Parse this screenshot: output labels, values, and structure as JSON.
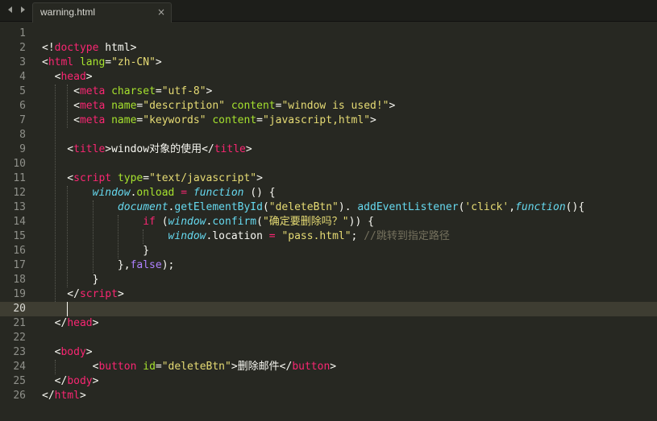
{
  "tab": {
    "title": "warning.html",
    "close_glyph": "×",
    "nav_back_icon": "triangle-left-icon",
    "nav_forward_icon": "triangle-right-icon"
  },
  "editor": {
    "current_line": 20,
    "theme": {
      "background": "#272822",
      "text": "#f8f8f2",
      "tag": "#f92672",
      "attribute": "#a6e22e",
      "string": "#e6db74",
      "keyword": "#f92672",
      "constant": "#ae81ff",
      "function": "#66d9ef",
      "storage": "#66d9ef",
      "comment": "#75715e",
      "line_number": "#8f908a",
      "current_line": "#3e3d32"
    },
    "lines": [
      {
        "num": "1",
        "tokens": []
      },
      {
        "num": "2",
        "tokens": [
          [
            "text",
            "<!"
          ],
          [
            "tag",
            "doctype"
          ],
          [
            "text",
            " html>"
          ]
        ]
      },
      {
        "num": "3",
        "tokens": [
          [
            "text",
            "<"
          ],
          [
            "tag",
            "html"
          ],
          [
            "text",
            " "
          ],
          [
            "attr",
            "lang"
          ],
          [
            "text",
            "="
          ],
          [
            "str",
            "\"zh-CN\""
          ],
          [
            "text",
            ">"
          ]
        ]
      },
      {
        "num": "4",
        "tokens": [
          [
            "text",
            "  <"
          ],
          [
            "tag",
            "head"
          ],
          [
            "text",
            ">"
          ]
        ]
      },
      {
        "num": "5",
        "tokens": [
          [
            "text",
            "     <"
          ],
          [
            "tag",
            "meta"
          ],
          [
            "text",
            " "
          ],
          [
            "attr",
            "charset"
          ],
          [
            "text",
            "="
          ],
          [
            "str",
            "\"utf-8\""
          ],
          [
            "text",
            ">"
          ]
        ]
      },
      {
        "num": "6",
        "tokens": [
          [
            "text",
            "     <"
          ],
          [
            "tag",
            "meta"
          ],
          [
            "text",
            " "
          ],
          [
            "attr",
            "name"
          ],
          [
            "text",
            "="
          ],
          [
            "str",
            "\"description\""
          ],
          [
            "text",
            " "
          ],
          [
            "attr",
            "content"
          ],
          [
            "text",
            "="
          ],
          [
            "str",
            "\"window is used!\""
          ],
          [
            "text",
            ">"
          ]
        ]
      },
      {
        "num": "7",
        "tokens": [
          [
            "text",
            "     <"
          ],
          [
            "tag",
            "meta"
          ],
          [
            "text",
            " "
          ],
          [
            "attr",
            "name"
          ],
          [
            "text",
            "="
          ],
          [
            "str",
            "\"keywords\""
          ],
          [
            "text",
            " "
          ],
          [
            "attr",
            "content"
          ],
          [
            "text",
            "="
          ],
          [
            "str",
            "\"javascript,html\""
          ],
          [
            "text",
            ">"
          ]
        ]
      },
      {
        "num": "8",
        "tokens": []
      },
      {
        "num": "9",
        "tokens": [
          [
            "text",
            "    <"
          ],
          [
            "tag",
            "title"
          ],
          [
            "text",
            ">window对象的使用</"
          ],
          [
            "tag",
            "title"
          ],
          [
            "text",
            ">"
          ]
        ]
      },
      {
        "num": "10",
        "tokens": []
      },
      {
        "num": "11",
        "tokens": [
          [
            "text",
            "    <"
          ],
          [
            "tag",
            "script"
          ],
          [
            "text",
            " "
          ],
          [
            "attr",
            "type"
          ],
          [
            "text",
            "="
          ],
          [
            "str",
            "\"text/javascript\""
          ],
          [
            "text",
            ">"
          ]
        ]
      },
      {
        "num": "12",
        "tokens": [
          [
            "text",
            "        "
          ],
          [
            "st",
            "window"
          ],
          [
            "text",
            "."
          ],
          [
            "attr",
            "onload"
          ],
          [
            "text",
            " "
          ],
          [
            "kw",
            "="
          ],
          [
            "text",
            " "
          ],
          [
            "st",
            "function"
          ],
          [
            "text",
            " () {"
          ]
        ]
      },
      {
        "num": "13",
        "tokens": [
          [
            "text",
            "            "
          ],
          [
            "st",
            "document"
          ],
          [
            "text",
            "."
          ],
          [
            "fn",
            "getElementById"
          ],
          [
            "text",
            "("
          ],
          [
            "str",
            "\"deleteBtn\""
          ],
          [
            "text",
            "). "
          ],
          [
            "fn",
            "addEventListener"
          ],
          [
            "text",
            "("
          ],
          [
            "str",
            "'click'"
          ],
          [
            "text",
            ","
          ],
          [
            "st",
            "function"
          ],
          [
            "text",
            "(){"
          ]
        ]
      },
      {
        "num": "14",
        "tokens": [
          [
            "text",
            "                "
          ],
          [
            "kw",
            "if"
          ],
          [
            "text",
            " ("
          ],
          [
            "st",
            "window"
          ],
          [
            "text",
            "."
          ],
          [
            "fn",
            "confirm"
          ],
          [
            "text",
            "("
          ],
          [
            "str",
            "\"确定要删除吗？\""
          ],
          [
            "text",
            ")) {"
          ]
        ]
      },
      {
        "num": "15",
        "tokens": [
          [
            "text",
            "                    "
          ],
          [
            "st",
            "window"
          ],
          [
            "text",
            ".location "
          ],
          [
            "kw",
            "="
          ],
          [
            "text",
            " "
          ],
          [
            "str",
            "\"pass.html\""
          ],
          [
            "text",
            "; "
          ],
          [
            "cm",
            "//跳转到指定路径"
          ]
        ]
      },
      {
        "num": "16",
        "tokens": [
          [
            "text",
            "                }"
          ]
        ]
      },
      {
        "num": "17",
        "tokens": [
          [
            "text",
            "            },"
          ],
          [
            "const",
            "false"
          ],
          [
            "text",
            ");"
          ]
        ]
      },
      {
        "num": "18",
        "tokens": [
          [
            "text",
            "        }"
          ]
        ]
      },
      {
        "num": "19",
        "tokens": [
          [
            "text",
            "    </"
          ],
          [
            "tag",
            "script"
          ],
          [
            "text",
            ">"
          ]
        ]
      },
      {
        "num": "20",
        "tokens": []
      },
      {
        "num": "21",
        "tokens": [
          [
            "text",
            "  </"
          ],
          [
            "tag",
            "head"
          ],
          [
            "text",
            ">"
          ]
        ]
      },
      {
        "num": "22",
        "tokens": []
      },
      {
        "num": "23",
        "tokens": [
          [
            "text",
            "  <"
          ],
          [
            "tag",
            "body"
          ],
          [
            "text",
            ">"
          ]
        ]
      },
      {
        "num": "24",
        "tokens": [
          [
            "text",
            "        <"
          ],
          [
            "tag",
            "button"
          ],
          [
            "text",
            " "
          ],
          [
            "attr",
            "id"
          ],
          [
            "text",
            "="
          ],
          [
            "str",
            "\"deleteBtn\""
          ],
          [
            "text",
            ">删除邮件</"
          ],
          [
            "tag",
            "button"
          ],
          [
            "text",
            ">"
          ]
        ]
      },
      {
        "num": "25",
        "tokens": [
          [
            "text",
            "  </"
          ],
          [
            "tag",
            "body"
          ],
          [
            "text",
            ">"
          ]
        ]
      },
      {
        "num": "26",
        "tokens": [
          [
            "text",
            "</"
          ],
          [
            "tag",
            "html"
          ],
          [
            "text",
            ">"
          ]
        ]
      }
    ]
  }
}
